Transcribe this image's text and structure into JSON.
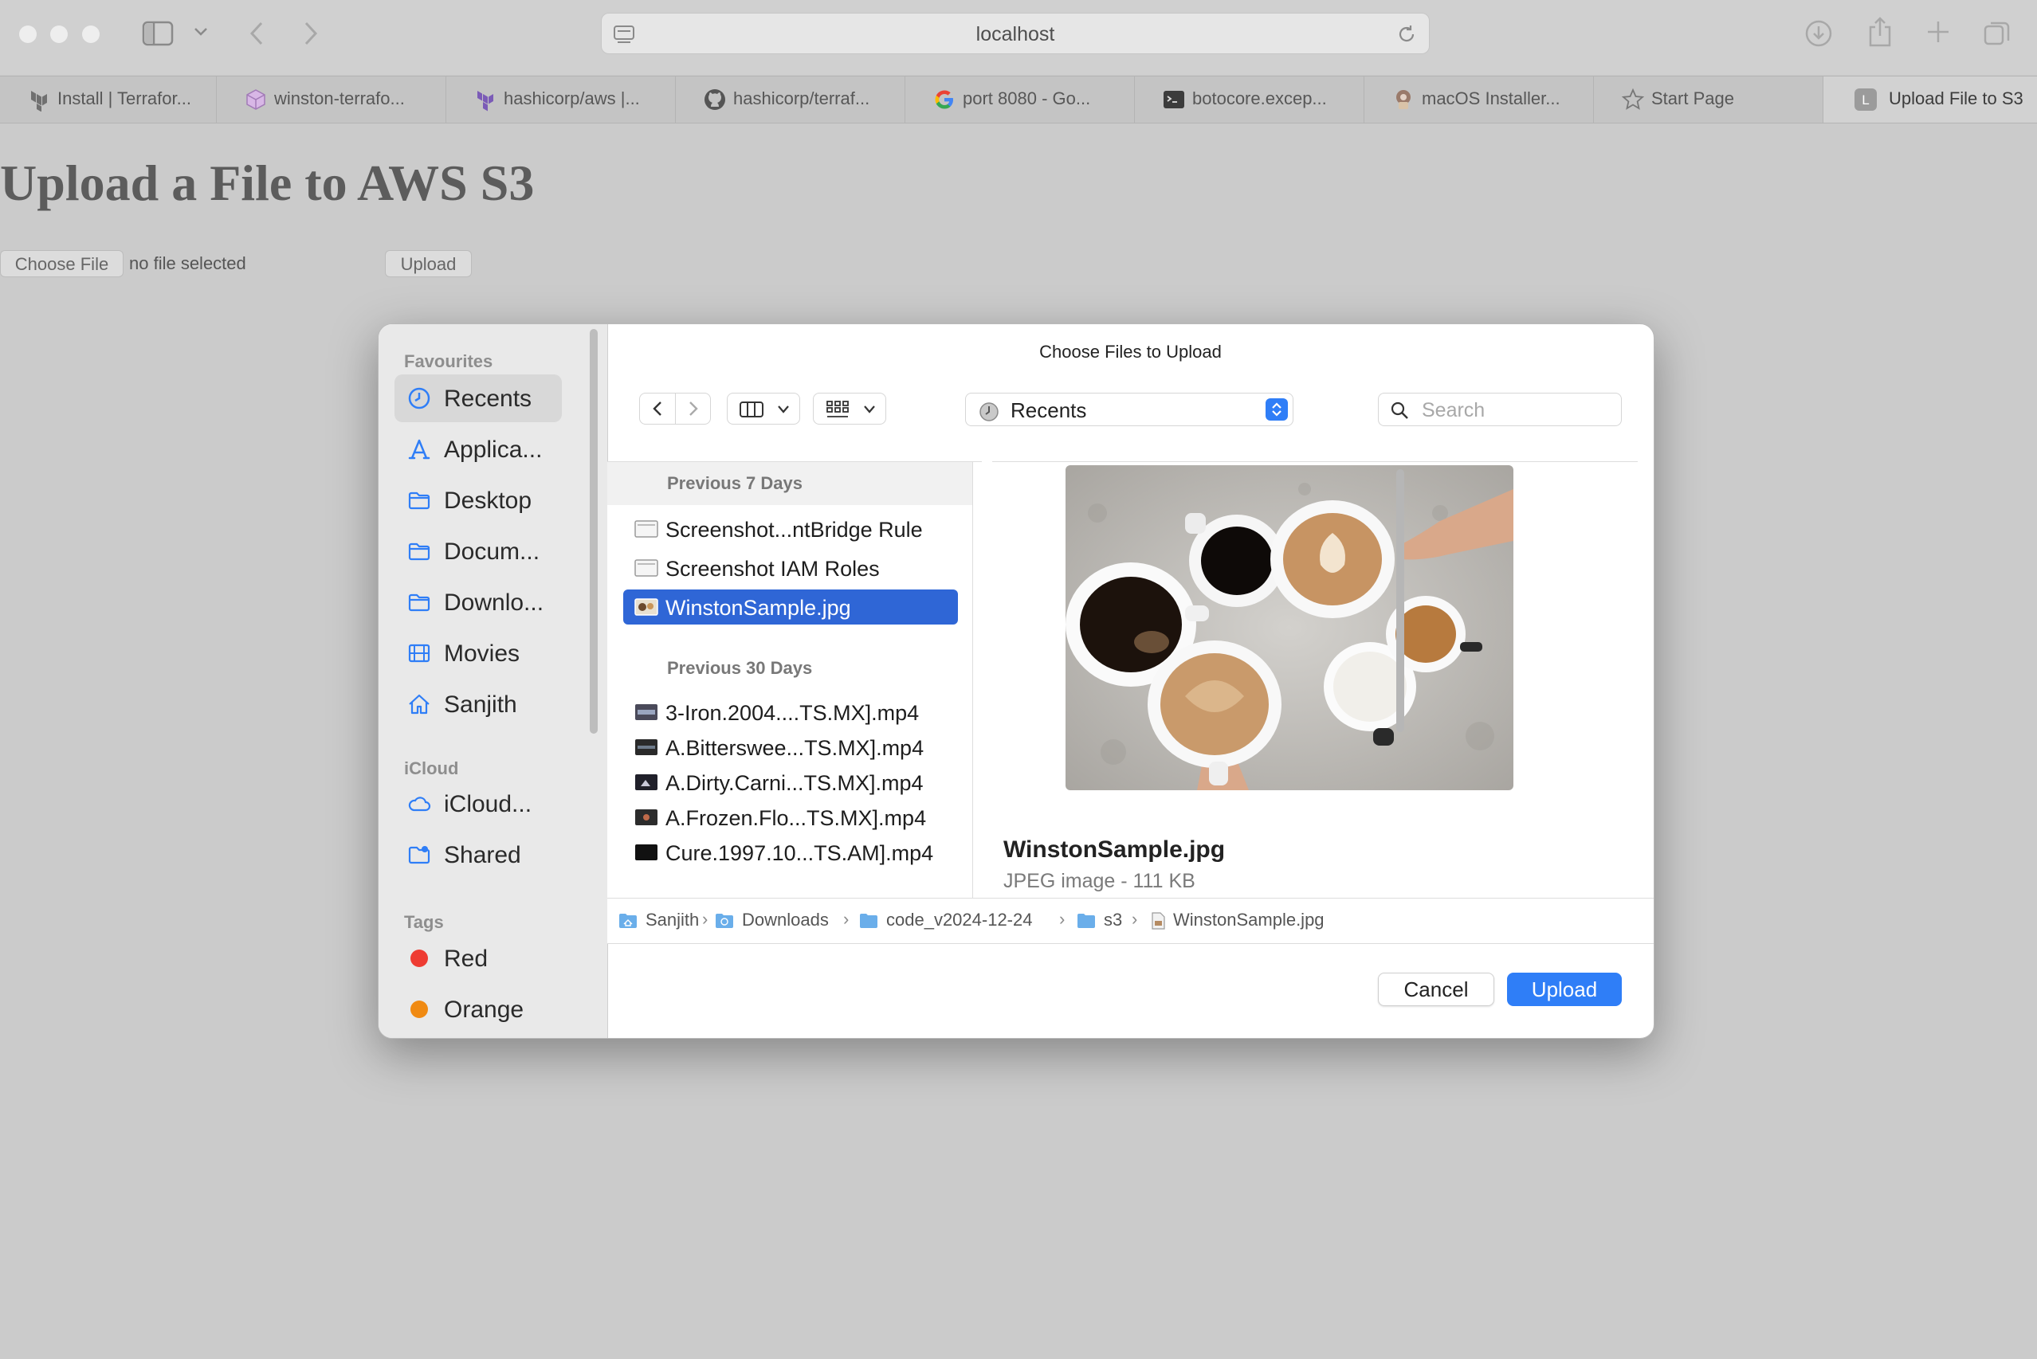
{
  "browser": {
    "address": "localhost",
    "tabs": [
      {
        "label": "Install | Terrafor...",
        "icon": "terraform-icon"
      },
      {
        "label": "winston-terrafo...",
        "icon": "cube-icon"
      },
      {
        "label": "hashicorp/aws |...",
        "icon": "terraform-icon"
      },
      {
        "label": "hashicorp/terraf...",
        "icon": "github-icon"
      },
      {
        "label": "port 8080 - Go...",
        "icon": "google-icon"
      },
      {
        "label": "botocore.excep...",
        "icon": "terminal-icon"
      },
      {
        "label": "macOS Installer...",
        "icon": "installer-icon"
      },
      {
        "label": "Start Page",
        "icon": "star-icon"
      },
      {
        "label": "Upload File to S3",
        "icon": "letter-l-icon"
      }
    ]
  },
  "page": {
    "heading": "Upload a File to AWS S3",
    "choose_label": "Choose File",
    "no_file": "no file selected",
    "upload_label": "Upload"
  },
  "dialog": {
    "title": "Choose Files to Upload",
    "location": "Recents",
    "search_placeholder": "Search",
    "sidebar": {
      "favourites_label": "Favourites",
      "favourites": [
        {
          "label": "Recents",
          "icon": "clock-icon"
        },
        {
          "label": "Applica...",
          "icon": "applications-icon"
        },
        {
          "label": "Desktop",
          "icon": "folder-icon"
        },
        {
          "label": "Docum...",
          "icon": "folder-icon"
        },
        {
          "label": "Downlo...",
          "icon": "folder-icon"
        },
        {
          "label": "Movies",
          "icon": "film-icon"
        },
        {
          "label": "Sanjith",
          "icon": "home-icon"
        }
      ],
      "icloud_label": "iCloud",
      "icloud": [
        {
          "label": "iCloud...",
          "icon": "cloud-icon"
        },
        {
          "label": "Shared",
          "icon": "shared-folder-icon"
        }
      ],
      "tags_label": "Tags",
      "tags": [
        {
          "label": "Red",
          "color": "#ee3b32"
        },
        {
          "label": "Orange",
          "color": "#f08a12"
        }
      ]
    },
    "groups": [
      {
        "label": "Previous 7 Days"
      },
      {
        "label": "Previous 30 Days"
      }
    ],
    "files": [
      {
        "label": "Screenshot...ntBridge Rule"
      },
      {
        "label": "Screenshot IAM Roles"
      },
      {
        "label": "WinstonSample.jpg"
      },
      {
        "label": "3-Iron.2004....TS.MX].mp4"
      },
      {
        "label": "A.Bitterswee...TS.MX].mp4"
      },
      {
        "label": "A.Dirty.Carni...TS.MX].mp4"
      },
      {
        "label": "A.Frozen.Flo...TS.MX].mp4"
      },
      {
        "label": "Cure.1997.10...TS.AM].mp4"
      }
    ],
    "preview": {
      "name": "WinstonSample.jpg",
      "meta": "JPEG image - 111 KB"
    },
    "path": [
      "Sanjith",
      "Downloads",
      "code_v2024-12-24",
      "s3",
      "WinstonSample.jpg"
    ],
    "cancel_label": "Cancel",
    "upload_label": "Upload",
    "accent_color": "#2f66d6"
  }
}
